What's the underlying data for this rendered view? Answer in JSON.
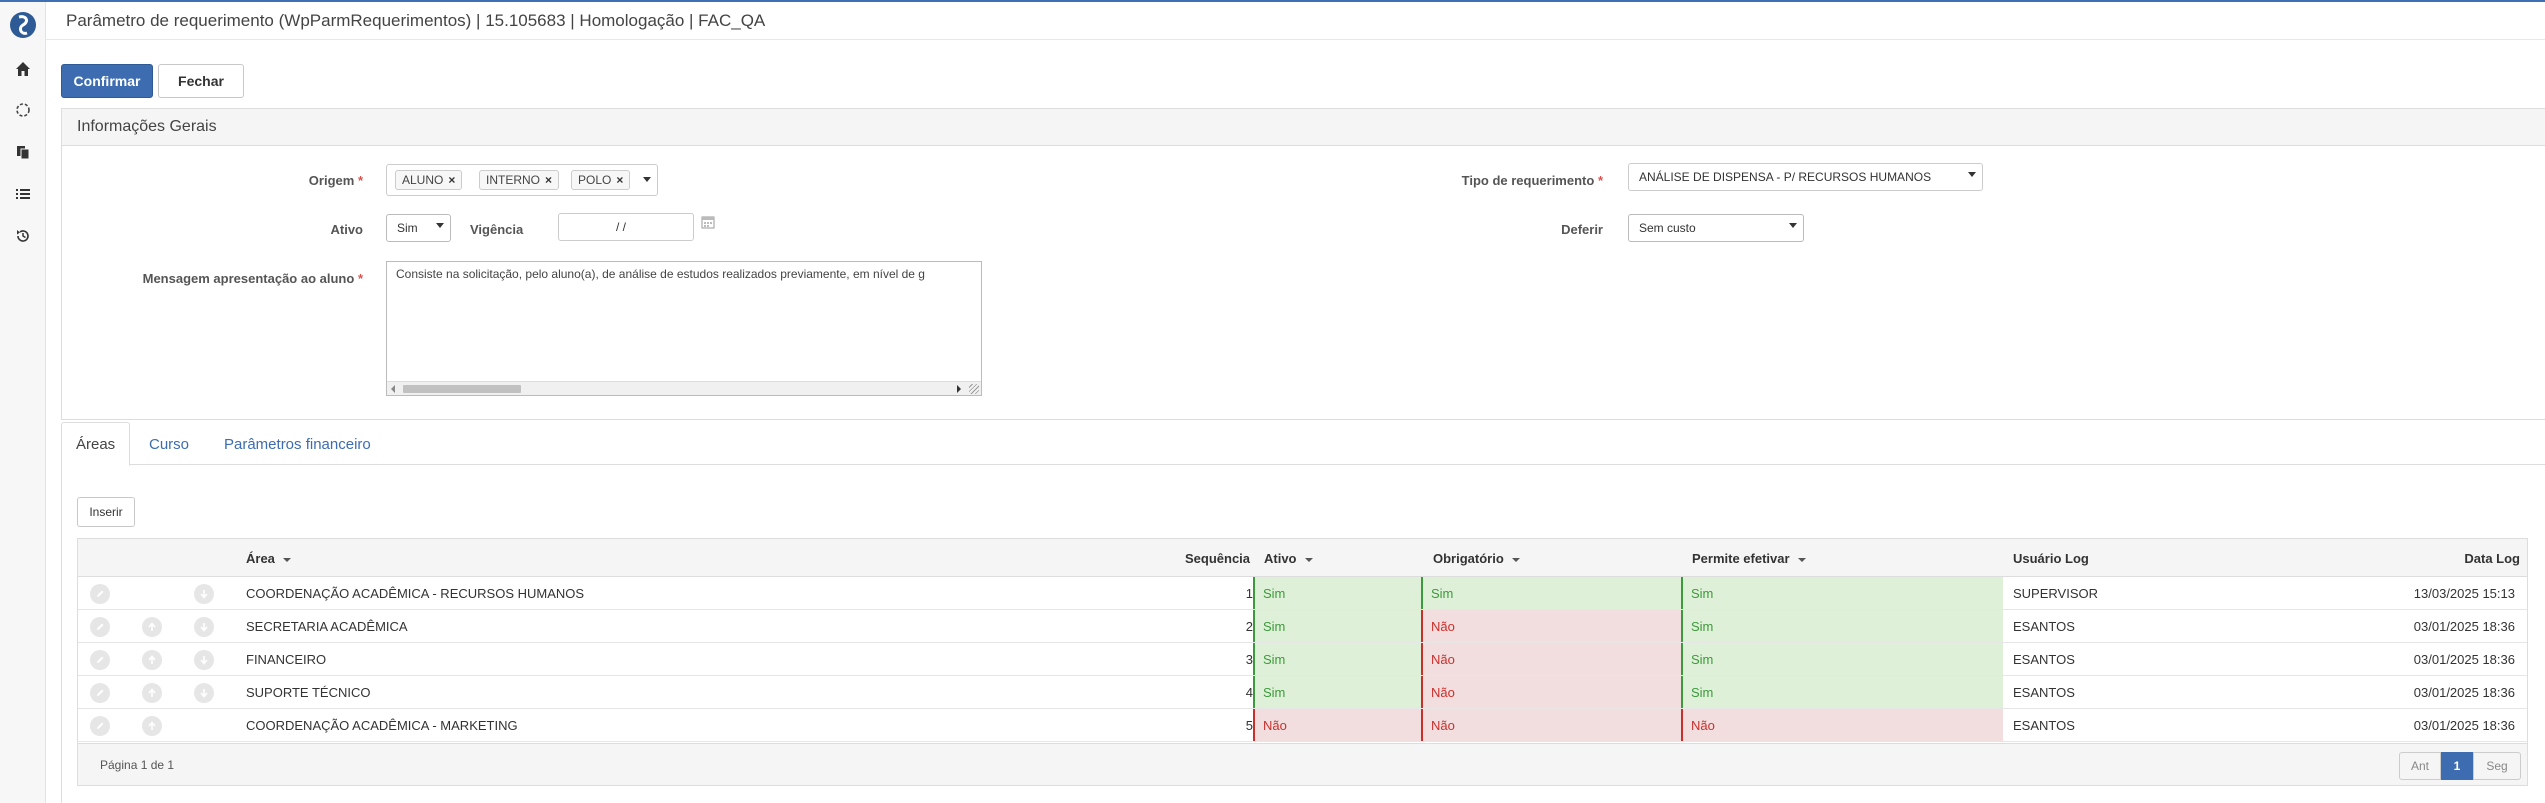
{
  "window": {
    "title": "Parâmetro de requerimento (WpParmRequerimentos) | 15.105683 | Homologação | FAC_QA"
  },
  "sidebar": {
    "icons": [
      "home-icon",
      "loading-icon",
      "copy-icon",
      "list-icon",
      "history-icon"
    ]
  },
  "toolbar": {
    "confirm_label": "Confirmar",
    "close_label": "Fechar"
  },
  "general_info": {
    "header": "Informações Gerais",
    "origem_label": "Origem",
    "origem_tags": [
      "ALUNO",
      "INTERNO",
      "POLO"
    ],
    "remove_glyph": "×",
    "tipo_label": "Tipo de requerimento",
    "tipo_value": "ANÁLISE DE DISPENSA - P/ RECURSOS HUMANOS",
    "ativo_label": "Ativo",
    "ativo_value": "Sim",
    "vigencia_label": "Vigência",
    "vigencia_value": "/ /",
    "deferir_label": "Deferir",
    "deferir_value": "Sem custo",
    "mensagem_label": "Mensagem apresentação ao aluno",
    "mensagem_value": "Consiste na solicitação, pelo aluno(a), de análise de estudos realizados previamente, em nível de g",
    "required_marker": "*"
  },
  "tabs": {
    "areas": "Áreas",
    "curso": "Curso",
    "financeiro": "Parâmetros financeiro"
  },
  "grid": {
    "insert_label": "Inserir",
    "headers": {
      "area": "Área",
      "sequencia": "Sequência",
      "ativo": "Ativo",
      "obrigatorio": "Obrigatório",
      "permite": "Permite efetivar",
      "usuario": "Usuário Log",
      "data": "Data Log"
    },
    "rows": [
      {
        "area": "COORDENAÇÃO ACADÊMICA - RECURSOS HUMANOS",
        "seq": "1",
        "ativo": "Sim",
        "obrigatorio": "Sim",
        "permite": "Sim",
        "usuario": "SUPERVISOR",
        "data": "13/03/2025 15:13"
      },
      {
        "area": "SECRETARIA ACADÊMICA",
        "seq": "2",
        "ativo": "Sim",
        "obrigatorio": "Não",
        "permite": "Sim",
        "usuario": "ESANTOS",
        "data": "03/01/2025 18:36"
      },
      {
        "area": "FINANCEIRO",
        "seq": "3",
        "ativo": "Sim",
        "obrigatorio": "Não",
        "permite": "Sim",
        "usuario": "ESANTOS",
        "data": "03/01/2025 18:36"
      },
      {
        "area": "SUPORTE TÉCNICO",
        "seq": "4",
        "ativo": "Sim",
        "obrigatorio": "Não",
        "permite": "Sim",
        "usuario": "ESANTOS",
        "data": "03/01/2025 18:36"
      },
      {
        "area": "COORDENAÇÃO ACADÊMICA - MARKETING",
        "seq": "5",
        "ativo": "Não",
        "obrigatorio": "Não",
        "permite": "Não",
        "usuario": "ESANTOS",
        "data": "03/01/2025 18:36"
      }
    ],
    "footer": {
      "page_info": "Página 1 de 1",
      "prev": "Ant",
      "current": "1",
      "next": "Seg"
    }
  },
  "colors": {
    "primary": "#3d6db0",
    "yes_bg": "#dff0d8",
    "no_bg": "#f2dede",
    "required": "#d9534f"
  }
}
